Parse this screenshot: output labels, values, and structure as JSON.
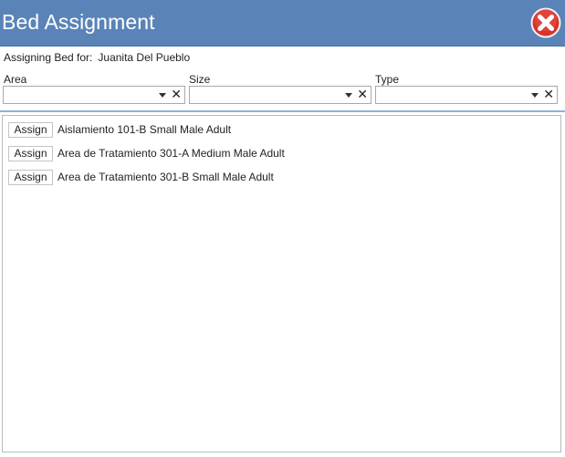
{
  "window": {
    "title": "Bed Assignment",
    "close_icon": "close-icon",
    "accent_color": "#5a84b8",
    "close_color": "#d8322c"
  },
  "assignment": {
    "label": "Assigning Bed for:",
    "patient_name": "Juanita Del Pueblo"
  },
  "filters": {
    "area": {
      "label": "Area",
      "value": ""
    },
    "size": {
      "label": "Size",
      "value": ""
    },
    "type": {
      "label": "Type",
      "value": ""
    },
    "dropdown_icon": "chevron-down-icon",
    "clear_icon": "clear-icon",
    "clear_glyph": "✕"
  },
  "beds": [
    {
      "button_label": "Assign",
      "description": "Aislamiento 101-B Small Male Adult"
    },
    {
      "button_label": "Assign",
      "description": "Area de Tratamiento 301-A Medium Male Adult"
    },
    {
      "button_label": "Assign",
      "description": "Area de Tratamiento 301-B Small Male Adult"
    }
  ]
}
